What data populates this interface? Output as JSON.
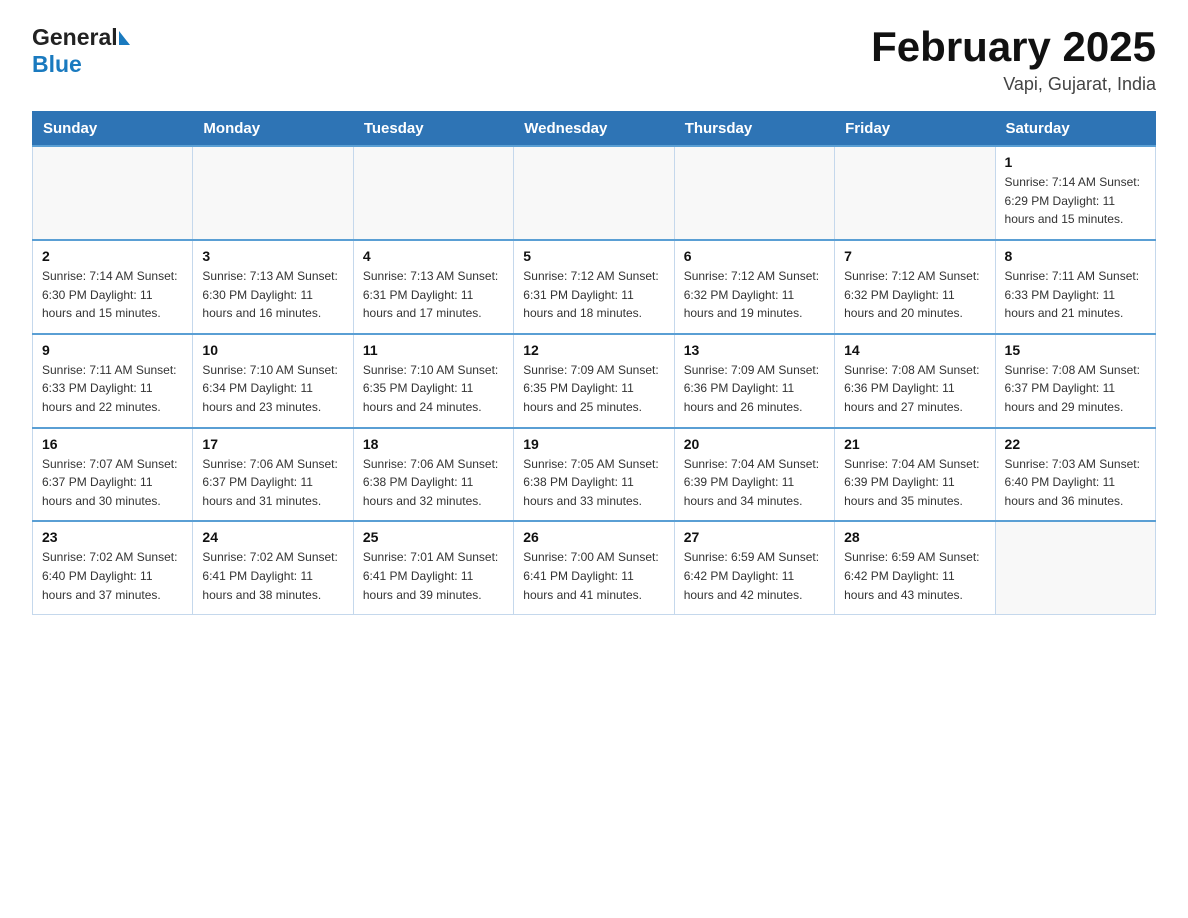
{
  "header": {
    "logo_general": "General",
    "logo_blue": "Blue",
    "month_title": "February 2025",
    "location": "Vapi, Gujarat, India"
  },
  "calendar": {
    "days_of_week": [
      "Sunday",
      "Monday",
      "Tuesday",
      "Wednesday",
      "Thursday",
      "Friday",
      "Saturday"
    ],
    "weeks": [
      [
        {
          "day": "",
          "info": ""
        },
        {
          "day": "",
          "info": ""
        },
        {
          "day": "",
          "info": ""
        },
        {
          "day": "",
          "info": ""
        },
        {
          "day": "",
          "info": ""
        },
        {
          "day": "",
          "info": ""
        },
        {
          "day": "1",
          "info": "Sunrise: 7:14 AM\nSunset: 6:29 PM\nDaylight: 11 hours\nand 15 minutes."
        }
      ],
      [
        {
          "day": "2",
          "info": "Sunrise: 7:14 AM\nSunset: 6:30 PM\nDaylight: 11 hours\nand 15 minutes."
        },
        {
          "day": "3",
          "info": "Sunrise: 7:13 AM\nSunset: 6:30 PM\nDaylight: 11 hours\nand 16 minutes."
        },
        {
          "day": "4",
          "info": "Sunrise: 7:13 AM\nSunset: 6:31 PM\nDaylight: 11 hours\nand 17 minutes."
        },
        {
          "day": "5",
          "info": "Sunrise: 7:12 AM\nSunset: 6:31 PM\nDaylight: 11 hours\nand 18 minutes."
        },
        {
          "day": "6",
          "info": "Sunrise: 7:12 AM\nSunset: 6:32 PM\nDaylight: 11 hours\nand 19 minutes."
        },
        {
          "day": "7",
          "info": "Sunrise: 7:12 AM\nSunset: 6:32 PM\nDaylight: 11 hours\nand 20 minutes."
        },
        {
          "day": "8",
          "info": "Sunrise: 7:11 AM\nSunset: 6:33 PM\nDaylight: 11 hours\nand 21 minutes."
        }
      ],
      [
        {
          "day": "9",
          "info": "Sunrise: 7:11 AM\nSunset: 6:33 PM\nDaylight: 11 hours\nand 22 minutes."
        },
        {
          "day": "10",
          "info": "Sunrise: 7:10 AM\nSunset: 6:34 PM\nDaylight: 11 hours\nand 23 minutes."
        },
        {
          "day": "11",
          "info": "Sunrise: 7:10 AM\nSunset: 6:35 PM\nDaylight: 11 hours\nand 24 minutes."
        },
        {
          "day": "12",
          "info": "Sunrise: 7:09 AM\nSunset: 6:35 PM\nDaylight: 11 hours\nand 25 minutes."
        },
        {
          "day": "13",
          "info": "Sunrise: 7:09 AM\nSunset: 6:36 PM\nDaylight: 11 hours\nand 26 minutes."
        },
        {
          "day": "14",
          "info": "Sunrise: 7:08 AM\nSunset: 6:36 PM\nDaylight: 11 hours\nand 27 minutes."
        },
        {
          "day": "15",
          "info": "Sunrise: 7:08 AM\nSunset: 6:37 PM\nDaylight: 11 hours\nand 29 minutes."
        }
      ],
      [
        {
          "day": "16",
          "info": "Sunrise: 7:07 AM\nSunset: 6:37 PM\nDaylight: 11 hours\nand 30 minutes."
        },
        {
          "day": "17",
          "info": "Sunrise: 7:06 AM\nSunset: 6:37 PM\nDaylight: 11 hours\nand 31 minutes."
        },
        {
          "day": "18",
          "info": "Sunrise: 7:06 AM\nSunset: 6:38 PM\nDaylight: 11 hours\nand 32 minutes."
        },
        {
          "day": "19",
          "info": "Sunrise: 7:05 AM\nSunset: 6:38 PM\nDaylight: 11 hours\nand 33 minutes."
        },
        {
          "day": "20",
          "info": "Sunrise: 7:04 AM\nSunset: 6:39 PM\nDaylight: 11 hours\nand 34 minutes."
        },
        {
          "day": "21",
          "info": "Sunrise: 7:04 AM\nSunset: 6:39 PM\nDaylight: 11 hours\nand 35 minutes."
        },
        {
          "day": "22",
          "info": "Sunrise: 7:03 AM\nSunset: 6:40 PM\nDaylight: 11 hours\nand 36 minutes."
        }
      ],
      [
        {
          "day": "23",
          "info": "Sunrise: 7:02 AM\nSunset: 6:40 PM\nDaylight: 11 hours\nand 37 minutes."
        },
        {
          "day": "24",
          "info": "Sunrise: 7:02 AM\nSunset: 6:41 PM\nDaylight: 11 hours\nand 38 minutes."
        },
        {
          "day": "25",
          "info": "Sunrise: 7:01 AM\nSunset: 6:41 PM\nDaylight: 11 hours\nand 39 minutes."
        },
        {
          "day": "26",
          "info": "Sunrise: 7:00 AM\nSunset: 6:41 PM\nDaylight: 11 hours\nand 41 minutes."
        },
        {
          "day": "27",
          "info": "Sunrise: 6:59 AM\nSunset: 6:42 PM\nDaylight: 11 hours\nand 42 minutes."
        },
        {
          "day": "28",
          "info": "Sunrise: 6:59 AM\nSunset: 6:42 PM\nDaylight: 11 hours\nand 43 minutes."
        },
        {
          "day": "",
          "info": ""
        }
      ]
    ]
  }
}
